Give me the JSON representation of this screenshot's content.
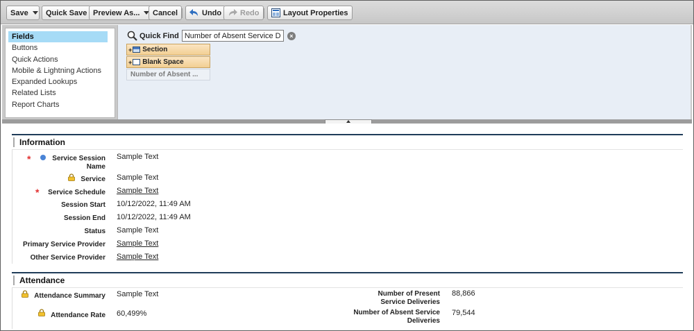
{
  "toolbar": {
    "save": "Save",
    "quick_save": "Quick Save",
    "preview_as": "Preview As...",
    "cancel": "Cancel",
    "undo": "Undo",
    "redo": "Redo",
    "layout_properties": "Layout Properties"
  },
  "palette": {
    "categories": [
      "Fields",
      "Buttons",
      "Quick Actions",
      "Mobile & Lightning Actions",
      "Expanded Lookups",
      "Related Lists",
      "Report Charts"
    ],
    "active_category": "Fields",
    "quick_find_label": "Quick Find",
    "quick_find_value": "Number of Absent Service D",
    "items": {
      "section": "Section",
      "blank_space": "Blank Space",
      "field": "Number of Absent ..."
    }
  },
  "information": {
    "title": "Information",
    "fields": [
      {
        "label": "Service Session Name",
        "value": "Sample Text"
      },
      {
        "label": "Service",
        "value": "Sample Text"
      },
      {
        "label": "Service Schedule",
        "value": "Sample Text"
      },
      {
        "label": "Session Start",
        "value": "10/12/2022, 11:49 AM"
      },
      {
        "label": "Session End",
        "value": "10/12/2022, 11:49 AM"
      },
      {
        "label": "Status",
        "value": "Sample Text"
      },
      {
        "label": "Primary Service Provider",
        "value": "Sample Text"
      },
      {
        "label": "Other Service Provider",
        "value": "Sample Text"
      }
    ]
  },
  "attendance": {
    "title": "Attendance",
    "left_fields": [
      {
        "label": "Attendance Summary",
        "value": "Sample Text"
      },
      {
        "label": "Attendance Rate",
        "value": "60,499%"
      }
    ],
    "right_fields": [
      {
        "label_line1": "Number of Present",
        "label_line2": "Service Deliveries",
        "value": "88,866"
      },
      {
        "label_line1": "Number of Absent Service",
        "label_line2": "Deliveries",
        "value": "79,544"
      }
    ]
  },
  "icons": {
    "required": "required-asterisk",
    "lock": "lock-icon",
    "dot": "blue-dot-icon",
    "search": "search-icon"
  },
  "colors": {
    "required": "#e23232",
    "section_rule": "#1f3c59",
    "active_category": "#a6dbf6",
    "palette_item": "#f2cf93"
  }
}
